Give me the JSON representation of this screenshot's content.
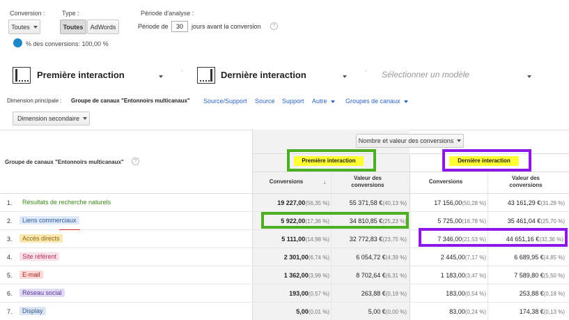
{
  "filters": {
    "conversion_label": "Conversion :",
    "conversion_value": "Toutes",
    "type_label": "Type :",
    "type_all": "Toutes",
    "type_adwords": "AdWords",
    "period_label": "Période d'analyse :",
    "period_prefix": "Période de",
    "period_days": "30",
    "period_suffix": "jours avant la conversion",
    "percent_text": "% des conversions: 100,00 %"
  },
  "models": {
    "first": "Première interaction",
    "last": "Dernière interaction",
    "select_placeholder": "Sélectionner un modèle"
  },
  "dimension": {
    "label": "Dimension principale :",
    "current": "Groupe de canaux \"Entonnoirs multicanaux\"",
    "links": [
      "Source/Support",
      "Source",
      "Support"
    ],
    "other": "Autre",
    "groups": "Groupes de canaux",
    "secondary": "Dimension secondaire"
  },
  "table": {
    "dimension_header": "Groupe de canaux \"Entonnoirs multicanaux\"",
    "metric_select": "Nombre et valeur des conversions",
    "first_header": "Première interaction",
    "last_header": "Dernière interaction",
    "col_conversions": "Conversions",
    "col_value_line1": "Valeur des",
    "col_value_line2": "conversions",
    "rows": [
      {
        "n": "1.",
        "channel": "Résultats de recherche naturels",
        "fc": "19 227,00",
        "fcp": "(56,35 %)",
        "fv": "55 371,58 €",
        "fvp": "(40,13 %)",
        "lc": "17 156,00",
        "lcp": "(50,28 %)",
        "lv": "43 161,29 €",
        "lvp": "(31,28 %)"
      },
      {
        "n": "2.",
        "channel": "Liens commerciaux",
        "fc": "5 922,00",
        "fcp": "(17,36 %)",
        "fv": "34 810,85 €",
        "fvp": "(25,23 %)",
        "lc": "5 725,00",
        "lcp": "(16,78 %)",
        "lv": "35 461,04 €",
        "lvp": "(25,70 %)"
      },
      {
        "n": "3.",
        "channel": "Accès directs",
        "fc": "5 111,00",
        "fcp": "(14,98 %)",
        "fv": "32 772,83 €",
        "fvp": "(23,75 %)",
        "lc": "7 346,00",
        "lcp": "(21,53 %)",
        "lv": "44 651,16 €",
        "lvp": "(32,36 %)"
      },
      {
        "n": "4.",
        "channel": "Site référent",
        "fc": "2 301,00",
        "fcp": "(6,74 %)",
        "fv": "6 054,72 €",
        "fvp": "(4,39 %)",
        "lc": "2 445,00",
        "lcp": "(7,17 %)",
        "lv": "6 689,95 €",
        "lvp": "(4,85 %)"
      },
      {
        "n": "5.",
        "channel": "E-mail",
        "fc": "1 362,00",
        "fcp": "(3,99 %)",
        "fv": "8 702,64 €",
        "fvp": "(6,31 %)",
        "lc": "1 183,00",
        "lcp": "(3,47 %)",
        "lv": "7 589,80 €",
        "lvp": "(5,50 %)"
      },
      {
        "n": "6.",
        "channel": "Réseau social",
        "fc": "193,00",
        "fcp": "(0,57 %)",
        "fv": "263,88 €",
        "fvp": "(0,19 %)",
        "lc": "183,00",
        "lcp": "(0,54 %)",
        "lv": "253,88 €",
        "lvp": "(0,18 %)"
      },
      {
        "n": "7.",
        "channel": "Display",
        "fc": "5,00",
        "fcp": "(0,01 %)",
        "fv": "5,00 €",
        "fvp": "(0,00 %)",
        "lc": "83,00",
        "lcp": "(0,24 %)",
        "lv": "174,38 €",
        "lvp": "(0,13 %)"
      }
    ]
  },
  "colors": {
    "green_box": "#4caf1f",
    "purple_box": "#8f16e8",
    "highlight_yellow": "#ffff33"
  }
}
